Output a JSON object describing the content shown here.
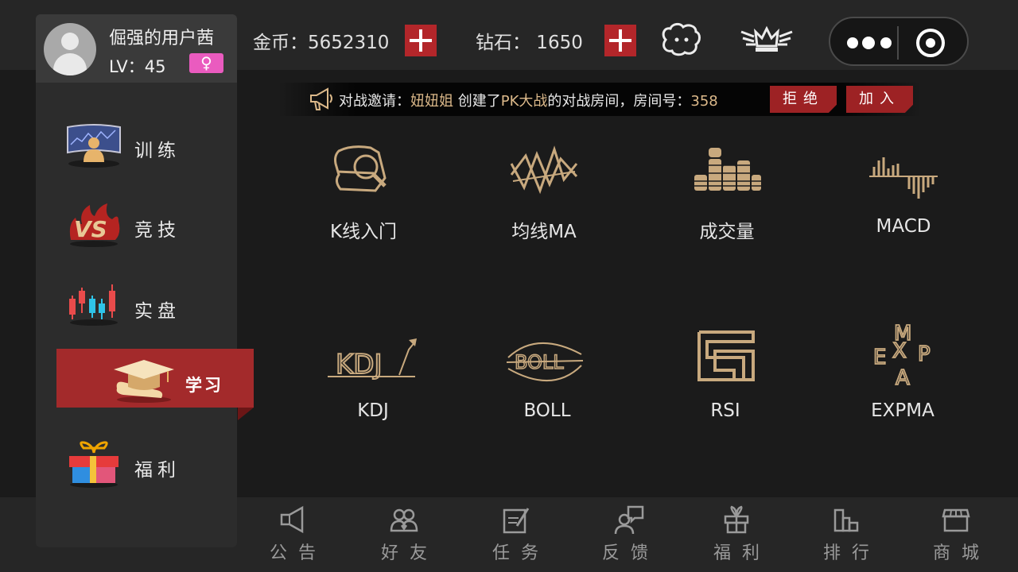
{
  "profile": {
    "username": "倔强的用户茜",
    "level": "LV：45",
    "gender_symbol": "♀"
  },
  "sidebar": {
    "items": [
      {
        "label": "训练",
        "icon": "training-screen-icon"
      },
      {
        "label": "竞技",
        "icon": "vs-flame-icon"
      },
      {
        "label": "实盘",
        "icon": "candlestick-icon"
      },
      {
        "label": "学习",
        "icon": "graduation-cap-icon",
        "active": true
      },
      {
        "label": "福利",
        "icon": "gift-box-icon"
      }
    ]
  },
  "topbar": {
    "coins_label": "金币：5652310",
    "diamonds_label": "钻石： 1650"
  },
  "invite": {
    "prefix": "对战邀请：",
    "inviter": "妞妞姐",
    "middle": "创建了",
    "mode": "PK大战",
    "suffix": "的对战房间，房间号：",
    "room": "358",
    "reject_label": "拒绝",
    "join_label": "加入"
  },
  "lessons": [
    {
      "label": "K线入门",
      "icon": "candle-magnifier-icon"
    },
    {
      "label": "均线MA",
      "icon": "moving-average-icon"
    },
    {
      "label": "成交量",
      "icon": "coin-stacks-icon"
    },
    {
      "label": "MACD",
      "icon": "macd-histogram-icon"
    },
    {
      "label": "KDJ",
      "icon": "kdj-icon"
    },
    {
      "label": "BOLL",
      "icon": "boll-icon"
    },
    {
      "label": "RSI",
      "icon": "rsi-icon"
    },
    {
      "label": "EXPMA",
      "icon": "expma-icon"
    }
  ],
  "bottom_nav": [
    {
      "label": "公告",
      "icon": "megaphone-icon"
    },
    {
      "label": "好友",
      "icon": "friends-icon"
    },
    {
      "label": "任务",
      "icon": "task-edit-icon"
    },
    {
      "label": "反馈",
      "icon": "feedback-icon"
    },
    {
      "label": "福利",
      "icon": "gift-icon"
    },
    {
      "label": "排行",
      "icon": "ranking-icon"
    },
    {
      "label": "商城",
      "icon": "shop-icon"
    }
  ],
  "colors": {
    "accent_red": "#a32a2b",
    "gold": "#c8a97e",
    "pink": "#ea5bbf"
  }
}
